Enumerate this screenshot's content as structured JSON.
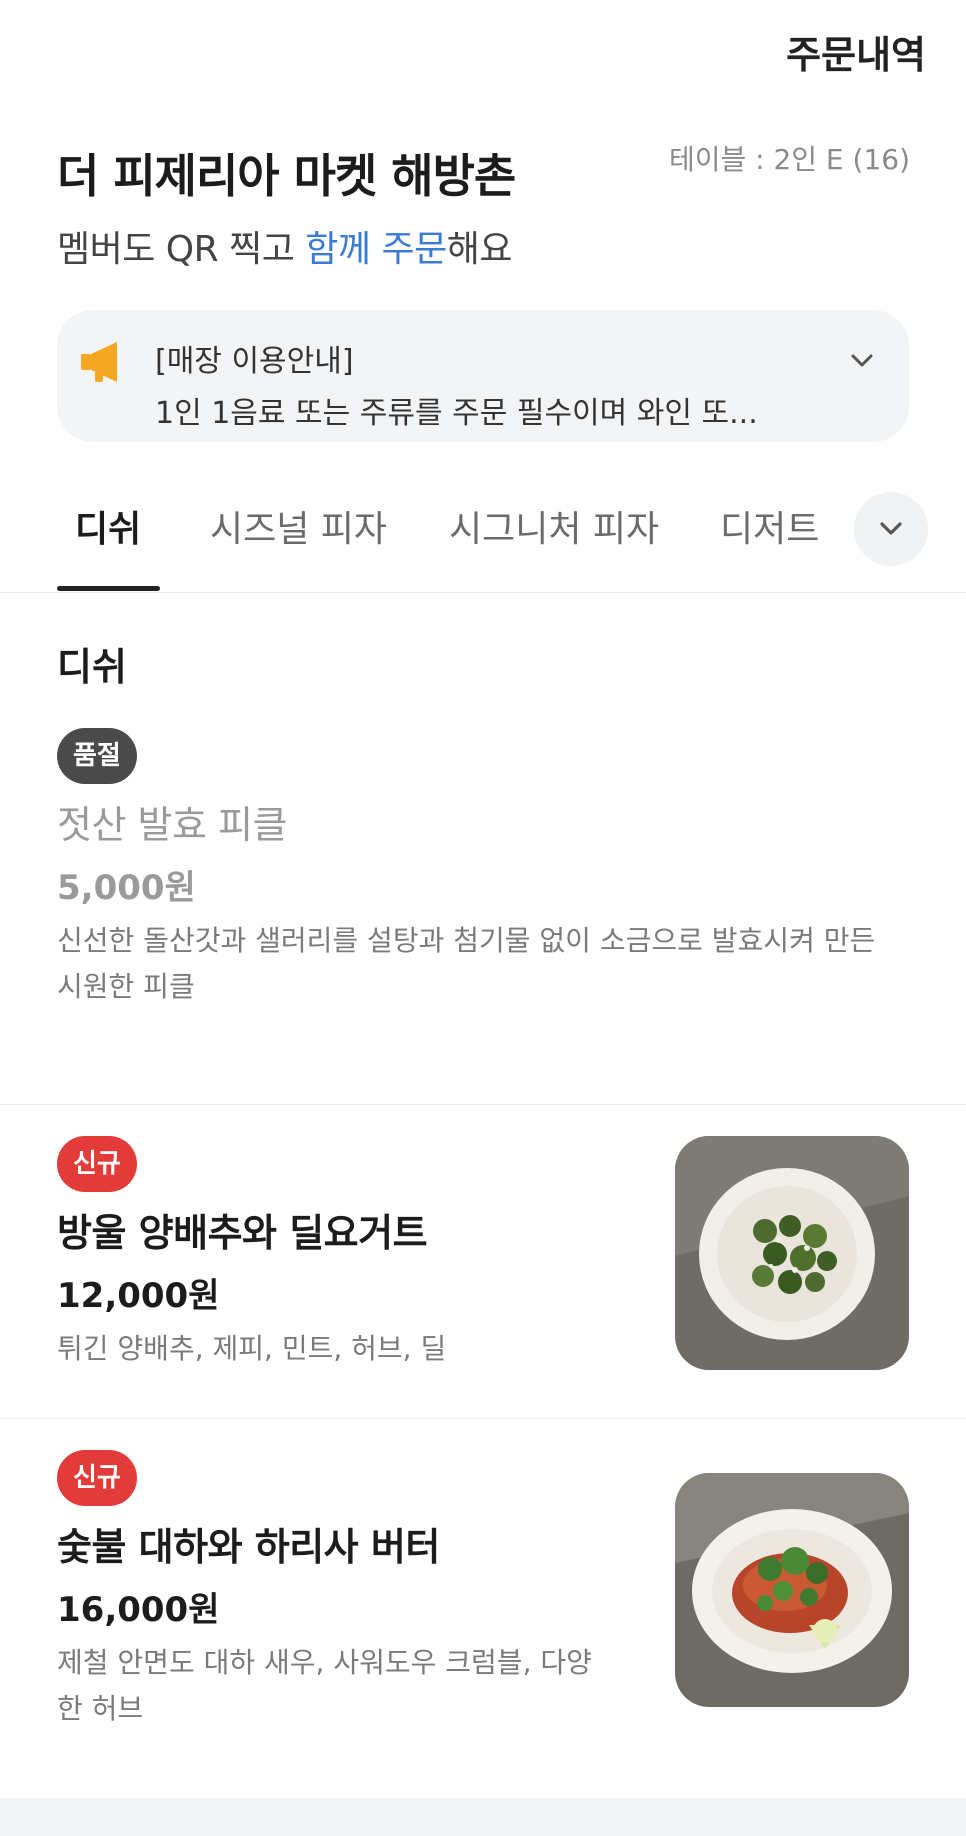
{
  "header": {
    "orders_link": "주문내역",
    "store_name": "더 피제리아 마켓 해방촌",
    "table_info": "테이블 : 2인 E (16)",
    "subtitle_prefix": "멤버도 QR 찍고 ",
    "subtitle_highlight": "함께 주문",
    "subtitle_suffix": "해요"
  },
  "notice": {
    "title": "[매장 이용안내]",
    "body": "1인 1음료 또는 주류를 주문 필수이며 와인 또...",
    "icon": "megaphone-icon"
  },
  "tabs": [
    {
      "label": "디쉬",
      "active": true
    },
    {
      "label": "시즈널 피자",
      "active": false
    },
    {
      "label": "시그니처 피자",
      "active": false
    },
    {
      "label": "디저트",
      "active": false
    }
  ],
  "section": {
    "title": "디쉬"
  },
  "items": [
    {
      "badge": "품절",
      "name": "젓산 발효 피클",
      "price": "5,000원",
      "desc": " 신선한 돌산갓과 샐러리를 설탕과 첨기물 없이 소금으로 발효시켜 만든 시원한 피클"
    },
    {
      "badge": "신규",
      "name": "방울 양배추와 딜요거트",
      "price": "12,000원",
      "desc": "튀긴 양배추, 제피, 민트, 허브, 딜"
    },
    {
      "badge": "신규",
      "name": "숯불 대하와 하리사 버터",
      "price": "16,000원",
      "desc": "제철 안면도 대하 새우, 사워도우 크럼블, 다양한 허브"
    }
  ],
  "colors": {
    "accent": "#3a7bd5",
    "new_badge": "#e33a3a",
    "soldout_badge": "#4a4a4a",
    "notice_bg": "#f3f4f6",
    "megaphone": "#f5a623"
  }
}
